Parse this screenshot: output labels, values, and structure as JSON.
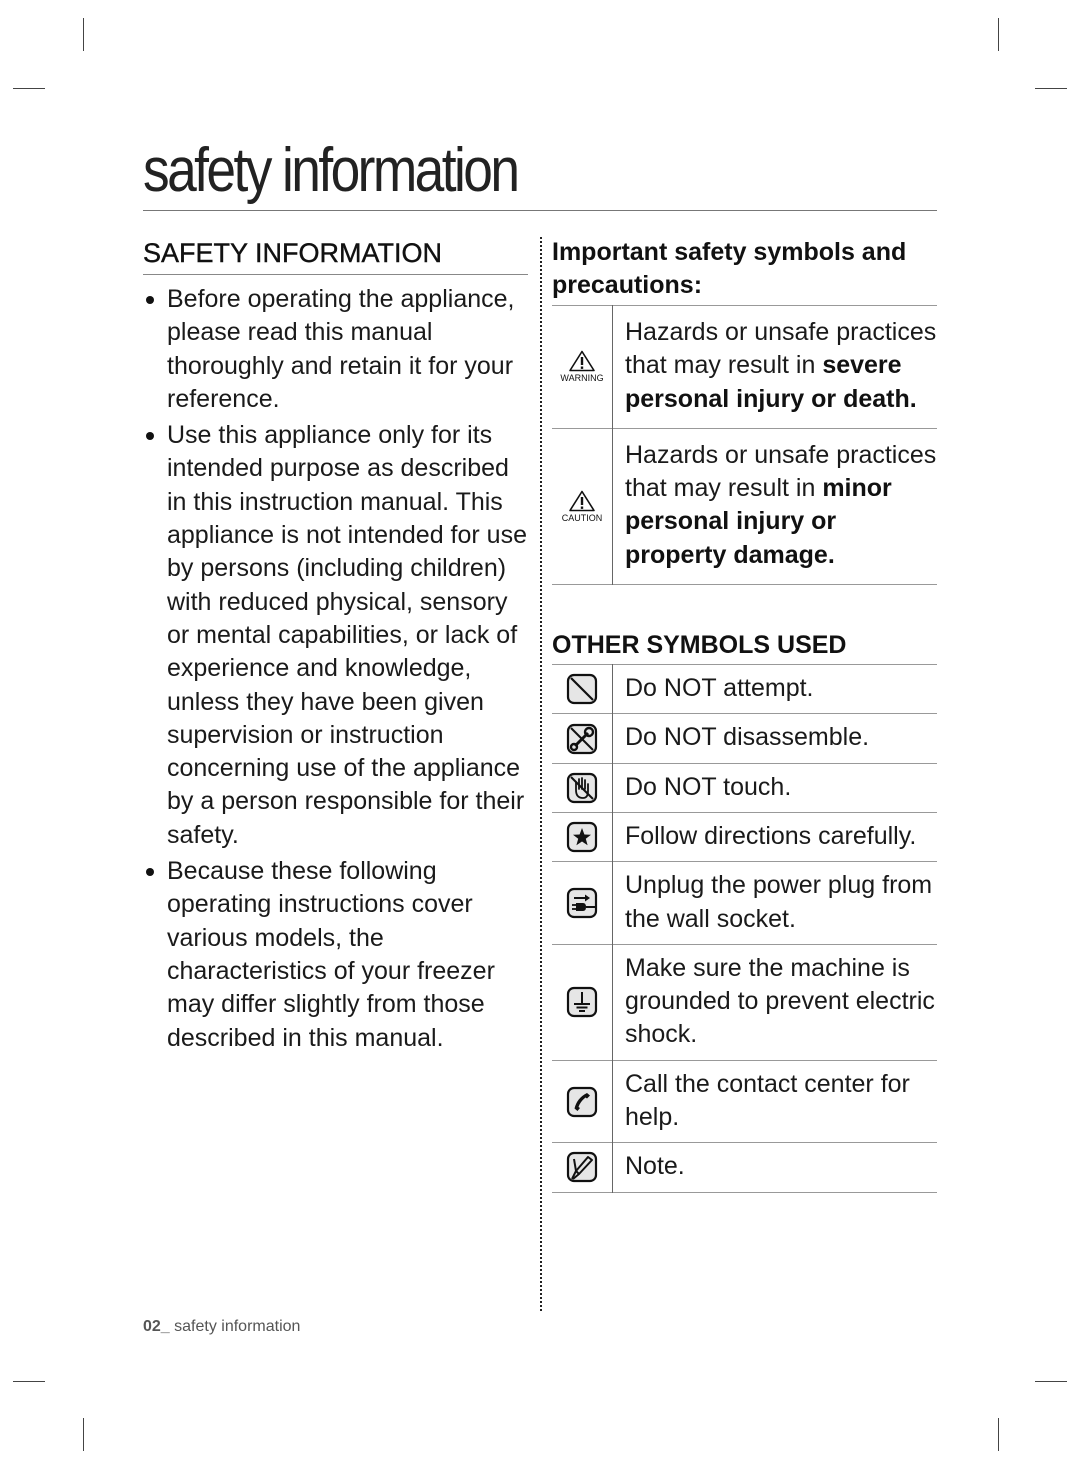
{
  "page": {
    "title": "safety information"
  },
  "left": {
    "heading": "SAFETY INFORMATION",
    "bullets": [
      "Before operating the appliance, please read this manual thoroughly and retain it for your reference.",
      "Use this appliance only for its intended purpose as described in this instruction manual. This appliance is not intended for use by persons (including children) with reduced physical, sensory or mental capabilities, or lack of experience and knowledge, unless they have been given supervision or instruction concerning use of the appliance by a person responsible for their safety.",
      "Because these following operating instructions cover various models, the characteristics of your freezer may differ slightly from those described in this manual."
    ]
  },
  "right": {
    "important_heading": "Important safety symbols and precautions:",
    "precautions": [
      {
        "icon": "warning-triangle-icon",
        "icon_label": "WARNING",
        "text_plain": "Hazards or unsafe practices that may result in ",
        "text_bold": "severe personal injury or death."
      },
      {
        "icon": "caution-triangle-icon",
        "icon_label": "CAUTION",
        "text_plain": "Hazards or unsafe practices that may result in ",
        "text_bold": "minor personal injury or property damage."
      }
    ],
    "other_heading": "OTHER SYMBOLS USED",
    "symbols": [
      {
        "icon": "do-not-attempt-icon",
        "text": "Do NOT attempt."
      },
      {
        "icon": "do-not-disassemble-icon",
        "text": "Do NOT disassemble."
      },
      {
        "icon": "do-not-touch-icon",
        "text": "Do NOT touch."
      },
      {
        "icon": "follow-directions-icon",
        "text": "Follow directions carefully."
      },
      {
        "icon": "unplug-icon",
        "text": "Unplug the power plug from the wall socket."
      },
      {
        "icon": "ground-icon",
        "text": "Make sure the machine is grounded to prevent electric shock."
      },
      {
        "icon": "call-contact-center-icon",
        "text": "Call the contact center for help."
      },
      {
        "icon": "note-icon",
        "text": "Note."
      }
    ]
  },
  "footer": {
    "page_number": "02_",
    "section": " safety information"
  }
}
